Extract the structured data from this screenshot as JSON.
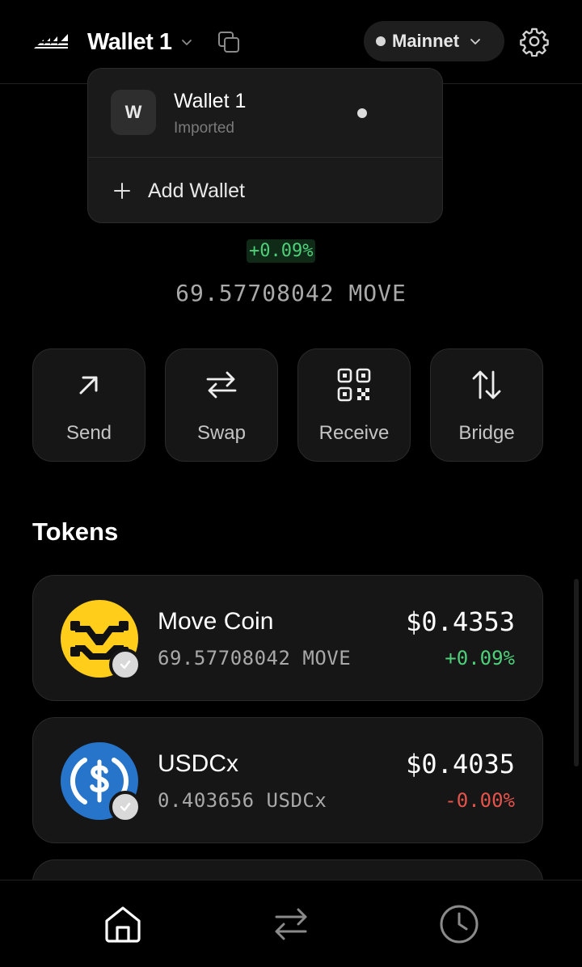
{
  "header": {
    "wallet_title": "Wallet 1",
    "network_label": "Mainnet"
  },
  "wallet_dropdown": {
    "wallets": [
      {
        "avatar_letter": "W",
        "name": "Wallet 1",
        "subtitle": "Imported",
        "active": true
      }
    ],
    "add_wallet_label": "Add Wallet"
  },
  "balance": {
    "change_percent": "+0.09%",
    "amount": "69.57708042 MOVE"
  },
  "actions": [
    {
      "label": "Send",
      "icon": "arrow-up-right-icon"
    },
    {
      "label": "Swap",
      "icon": "swap-arrows-icon"
    },
    {
      "label": "Receive",
      "icon": "qr-code-icon"
    },
    {
      "label": "Bridge",
      "icon": "bridge-arrows-icon"
    }
  ],
  "tokens": {
    "title": "Tokens",
    "items": [
      {
        "name": "Move Coin",
        "balance": "69.57708042 MOVE",
        "price": "$0.4353",
        "change": "+0.09%",
        "change_positive": true,
        "icon": "move-coin-icon",
        "icon_color": "#FFCD1A"
      },
      {
        "name": "USDCx",
        "balance": "0.403656 USDCx",
        "price": "$0.4035",
        "change": "-0.00%",
        "change_positive": false,
        "icon": "usdc-icon",
        "icon_color": "#2775CA"
      }
    ]
  },
  "bottom_nav": [
    {
      "icon": "home-icon",
      "active": true
    },
    {
      "icon": "transfer-icon",
      "active": false
    },
    {
      "icon": "history-clock-icon",
      "active": false
    }
  ],
  "colors": {
    "positive": "#4ED07A",
    "negative": "#E5534B",
    "card_background": "#161616"
  }
}
